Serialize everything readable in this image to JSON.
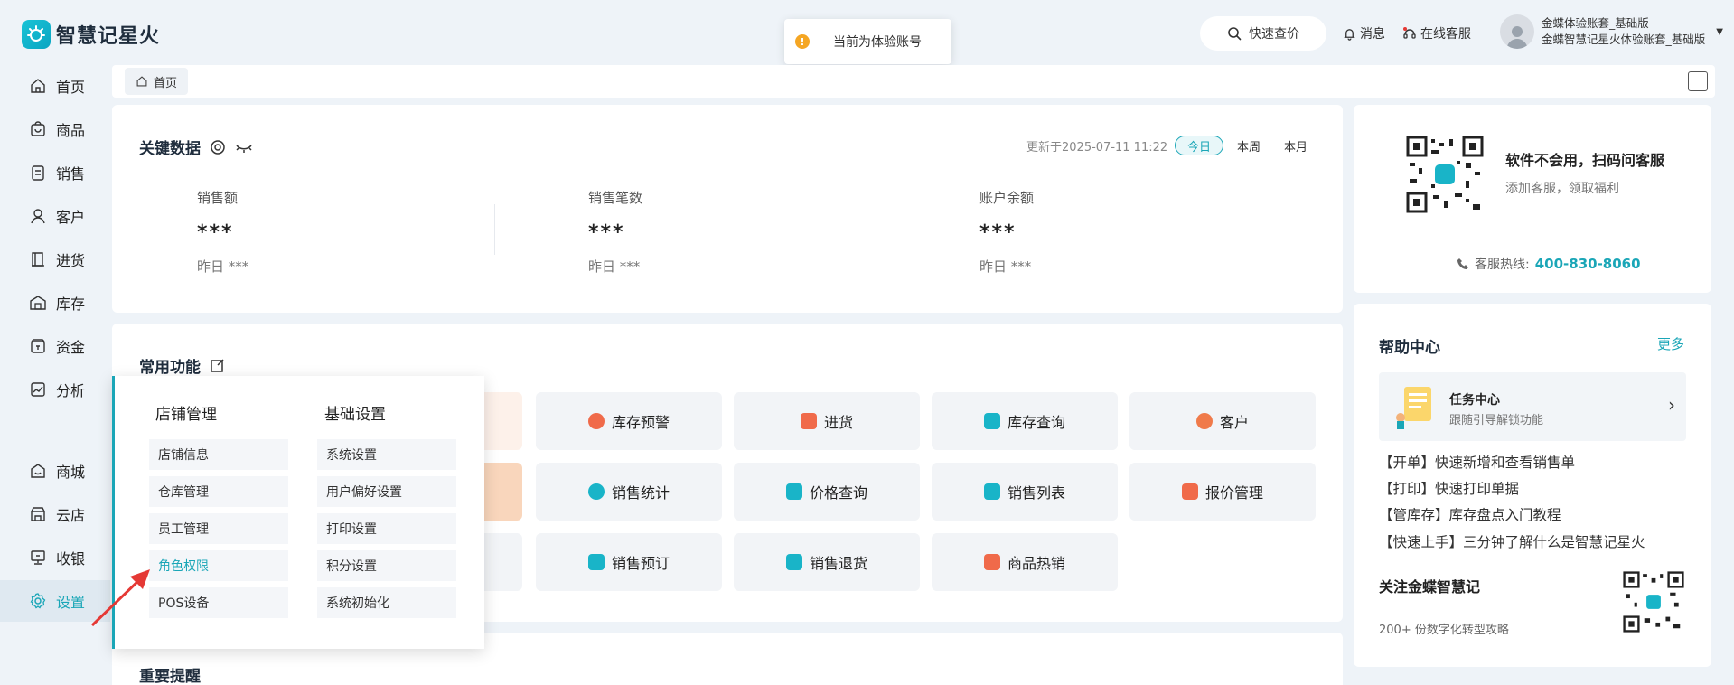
{
  "app": {
    "name": "智慧记星火"
  },
  "header": {
    "toast": "当前为体验账号",
    "quick_price": "快速查价",
    "messages": "消息",
    "online_service": "在线客服",
    "user": {
      "account": "金蝶体验账套_基础版",
      "company": "金蝶智慧记星火体验账套_基础版"
    }
  },
  "sidebar": {
    "items": [
      {
        "label": "首页",
        "icon": "home-icon"
      },
      {
        "label": "商品",
        "icon": "goods-icon"
      },
      {
        "label": "销售",
        "icon": "sales-icon"
      },
      {
        "label": "客户",
        "icon": "customer-icon"
      },
      {
        "label": "进货",
        "icon": "purchase-icon"
      },
      {
        "label": "库存",
        "icon": "warehouse-icon"
      },
      {
        "label": "资金",
        "icon": "wallet-icon"
      },
      {
        "label": "分析",
        "icon": "chart-icon"
      },
      {
        "label": "商城",
        "icon": "shop-icon"
      },
      {
        "label": "云店",
        "icon": "cloud-store-icon"
      },
      {
        "label": "收银",
        "icon": "cashier-icon"
      },
      {
        "label": "设置",
        "icon": "gear-icon"
      }
    ]
  },
  "tabs": [
    {
      "label": "首页"
    }
  ],
  "key_data": {
    "title": "关键数据",
    "updated": "更新于2025-07-11 11:22",
    "periods": [
      "今日",
      "本周",
      "本月"
    ],
    "metrics": [
      {
        "label": "销售额",
        "value": "***",
        "yesterday": "昨日 ***"
      },
      {
        "label": "销售笔数",
        "value": "***",
        "yesterday": "昨日 ***"
      },
      {
        "label": "账户余额",
        "value": "***",
        "yesterday": "昨日 ***"
      }
    ]
  },
  "common_functions": {
    "title": "常用功能",
    "buttons": [
      {
        "label": "库存预警",
        "color": "#f06a4a"
      },
      {
        "label": "进货",
        "color": "#f06a4a"
      },
      {
        "label": "库存查询",
        "color": "#19b4c8"
      },
      {
        "label": "客户",
        "color": "#f07a4a"
      },
      {
        "label": "销售统计",
        "color": "#19b4c8"
      },
      {
        "label": "价格查询",
        "color": "#19b4c8"
      },
      {
        "label": "销售列表",
        "color": "#19b4c8"
      },
      {
        "label": "报价管理",
        "color": "#f06a4a"
      },
      {
        "label": "销售预订",
        "color": "#19b4c8"
      },
      {
        "label": "销售退货",
        "color": "#19b4c8"
      },
      {
        "label": "商品热销",
        "color": "#f06a4a"
      }
    ]
  },
  "settings_popup": {
    "col1": {
      "title": "店铺管理",
      "items": [
        "店铺信息",
        "仓库管理",
        "员工管理",
        "角色权限",
        "POS设备"
      ]
    },
    "col2": {
      "title": "基础设置",
      "items": [
        "系统设置",
        "用户偏好设置",
        "打印设置",
        "积分设置",
        "系统初始化"
      ]
    }
  },
  "service": {
    "title": "软件不会用，扫码问客服",
    "subtitle": "添加客服，领取福利",
    "hotline_label": "客服热线:",
    "hotline": "400-830-8060"
  },
  "help": {
    "title": "帮助中心",
    "more": "更多",
    "task": {
      "title": "任务中心",
      "subtitle": "跟随引导解锁功能"
    },
    "links": [
      "【开单】快速新增和查看销售单",
      "【打印】快速打印单据",
      "【管库存】库存盘点入门教程",
      "【快速上手】三分钟了解什么是智慧记星火"
    ],
    "follow_title": "关注金蝶智慧记",
    "follow_sub": "200+ 份数字化转型攻略"
  },
  "reminders": {
    "title": "重要提醒"
  },
  "colors": {
    "accent": "#1aa6b7",
    "warning": "#f5a623",
    "danger_arrow": "#e53935"
  }
}
